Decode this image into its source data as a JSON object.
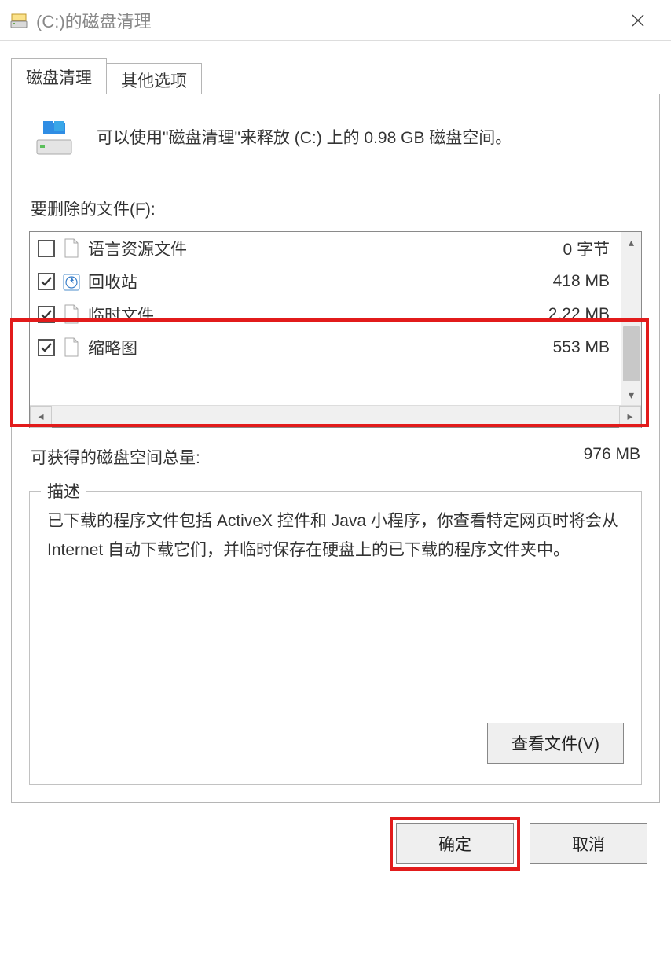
{
  "titlebar": {
    "title": "(C:)的磁盘清理"
  },
  "tabs": {
    "active": "磁盘清理",
    "inactive": "其他选项"
  },
  "info": {
    "text": "可以使用\"磁盘清理\"来释放  (C:) 上的 0.98 GB 磁盘空间。"
  },
  "files": {
    "label": "要删除的文件(F):",
    "items": [
      {
        "checked": false,
        "icon": "file",
        "name": "语言资源文件",
        "size": "0 字节"
      },
      {
        "checked": true,
        "icon": "recycle",
        "name": "回收站",
        "size": "418 MB"
      },
      {
        "checked": true,
        "icon": "file",
        "name": "临时文件",
        "size": "2.22 MB"
      },
      {
        "checked": true,
        "icon": "file",
        "name": "缩略图",
        "size": "553 MB"
      }
    ]
  },
  "total": {
    "label": "可获得的磁盘空间总量:",
    "value": "976 MB"
  },
  "description": {
    "legend": "描述",
    "text": "已下载的程序文件包括 ActiveX 控件和 Java 小程序，你查看特定网页时将会从 Internet 自动下载它们，并临时保存在硬盘上的已下载的程序文件夹中。"
  },
  "buttons": {
    "viewFiles": "查看文件(V)",
    "ok": "确定",
    "cancel": "取消"
  }
}
